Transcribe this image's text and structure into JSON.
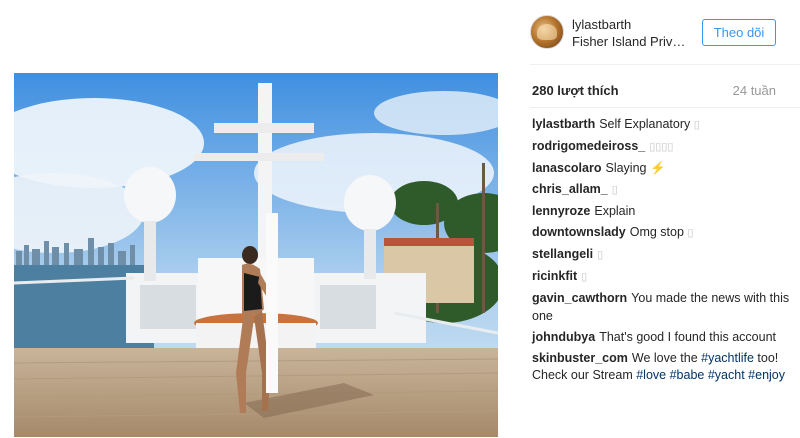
{
  "post": {
    "username": "lylastbarth",
    "location": "Fisher Island Private Beach",
    "follow_label": "Theo dõi",
    "likes": "280 lượt thích",
    "time_ago": "24 tuần",
    "photo_alt": "Woman posing on the deck of a yacht"
  },
  "comments": [
    {
      "user": "lylastbarth",
      "text": "Self Explanatory",
      "glyph": "▯"
    },
    {
      "user": "rodrigomedeiross_",
      "text": "",
      "glyph": "▯▯▯▯"
    },
    {
      "user": "lanascolaro",
      "text": "Slaying ⚡",
      "glyph": ""
    },
    {
      "user": "chris_allam_",
      "text": "",
      "glyph": "▯"
    },
    {
      "user": "lennyroze",
      "text": "Explain",
      "glyph": ""
    },
    {
      "user": "downtownslady",
      "text": "Omg stop",
      "glyph": "▯"
    },
    {
      "user": "stellangeli",
      "text": "",
      "glyph": "▯"
    },
    {
      "user": "ricinkfit",
      "text": "",
      "glyph": "▯"
    },
    {
      "user": "gavin_cawthorn",
      "text": "You made the news with this one",
      "glyph": ""
    },
    {
      "user": "johndubya",
      "text": "That's good I found this account",
      "glyph": ""
    },
    {
      "user": "skinbuster_com",
      "text": "We love the ",
      "glyph": ""
    }
  ],
  "last_comment": {
    "tag1": "#yachtlife",
    "mid": " too! Check our Stream ",
    "tag2": "#love",
    "tag3": "#babe",
    "tag4": "#yacht",
    "tag5": "#enjoy"
  },
  "colors": {
    "accent": "#3897f0",
    "text": "#262626",
    "muted": "#999999",
    "hashtag": "#003569"
  }
}
